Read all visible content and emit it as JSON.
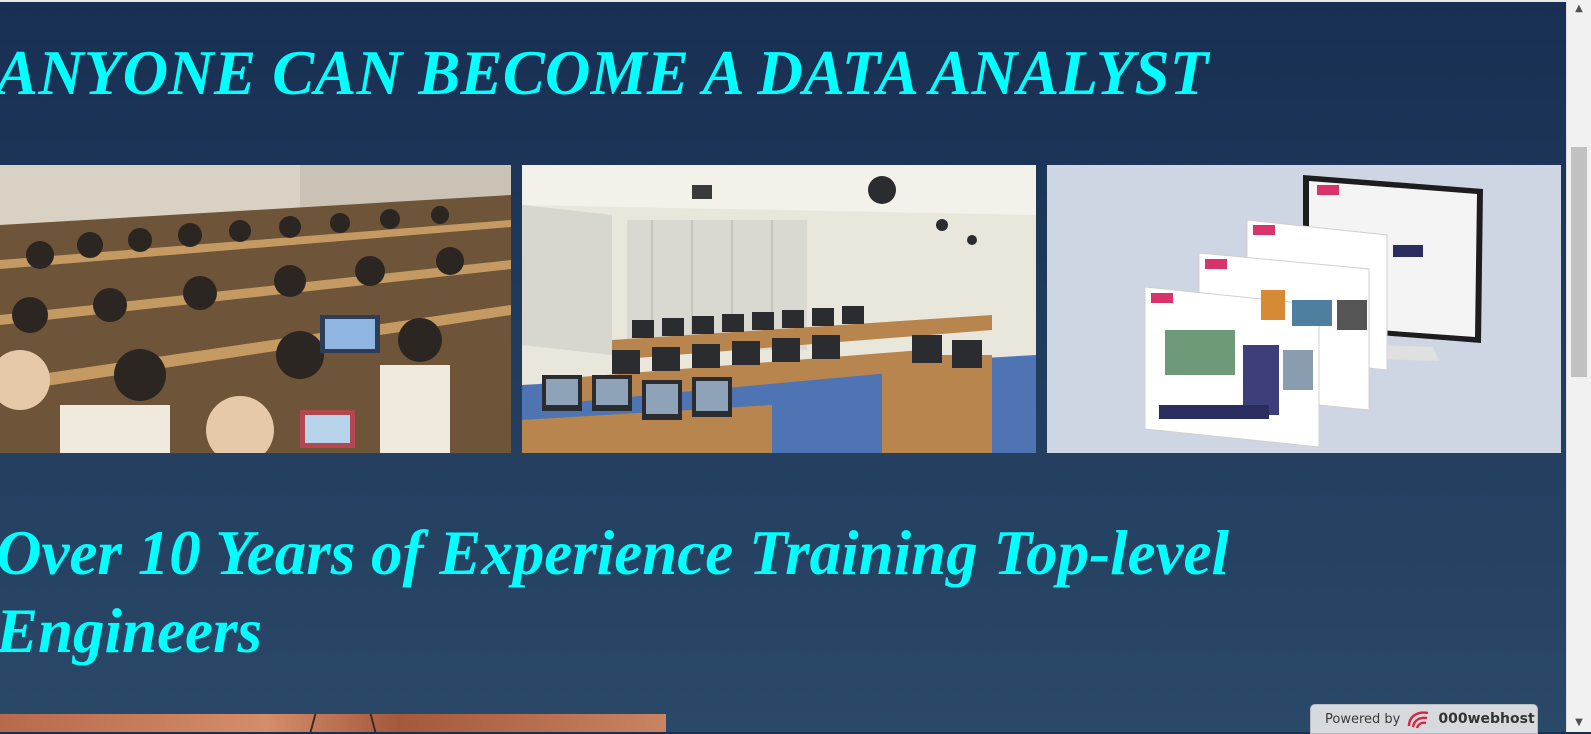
{
  "hero": {
    "title": "ANYONE CAN BECOME A DATA ANALYST"
  },
  "gallery": {
    "images": [
      {
        "name": "lecture-hall-photo"
      },
      {
        "name": "computer-lab-photo"
      },
      {
        "name": "website-screens-photo"
      }
    ]
  },
  "section": {
    "heading": "Over 10 Years of Experience Training Top-level Engineers"
  },
  "badge": {
    "powered_label": "Powered by",
    "brand": "000webhost"
  },
  "scrollbar": {
    "up_icon": "▲",
    "down_icon": "▼"
  },
  "colors": {
    "heading": "#00ffff",
    "background": "#1e3556"
  }
}
